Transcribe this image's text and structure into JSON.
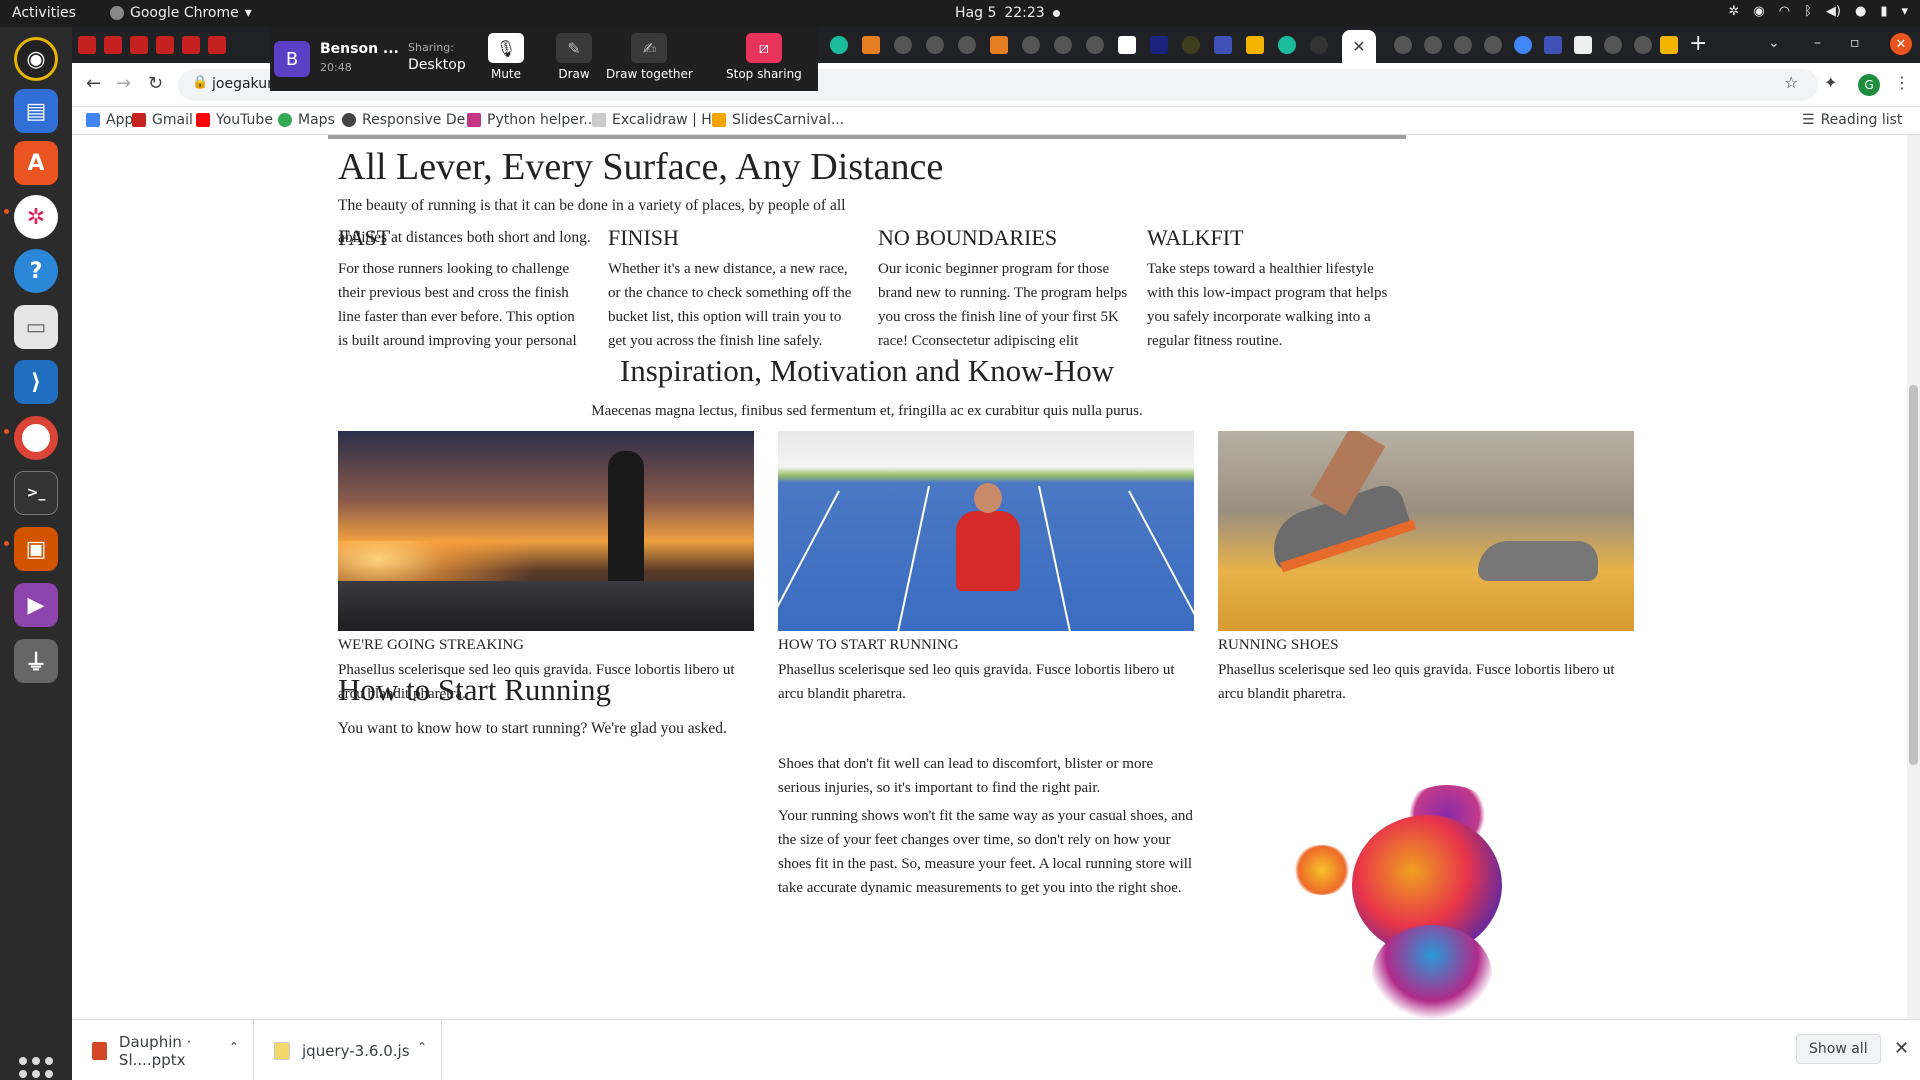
{
  "topbar": {
    "activities": "Activities",
    "app_name": "Google Chrome",
    "clock_day": "Hag 5",
    "clock_time": "22:23"
  },
  "share": {
    "avatar_letter": "B",
    "name": "Benson ...",
    "time": "20:48",
    "sharing_label": "Sharing:",
    "sharing_value": "Desktop",
    "mute": "Mute",
    "draw": "Draw",
    "draw_together": "Draw together",
    "stop_sharing": "Stop sharing"
  },
  "browser": {
    "url": "joegakur",
    "profile_letter": "G",
    "bookmarks": [
      "Apps",
      "Gmail",
      "YouTube",
      "Maps",
      "Responsive De...",
      "Python helper...",
      "Excalidraw | H...",
      "SlidesCarnival..."
    ],
    "reading_list": "Reading list"
  },
  "page": {
    "title": "All Lever, Every Surface, Any Distance",
    "intro_line1": "The beauty of running is that it can be done in a variety of places, by people of all",
    "intro_line2": "abilities at distances both short and long.",
    "features": [
      {
        "title": "FAST",
        "text": "For those runners looking to challenge their previous best and cross the finish line faster than ever before. This option is built around improving your personal"
      },
      {
        "title": "FINISH",
        "text": "Whether it's a new distance, a new race, or the chance to check something off the bucket list, this option will train you to get you across the finish line safely."
      },
      {
        "title": "NO BOUNDARIES",
        "text": "Our iconic beginner program for those brand new to running. The program helps you cross the finish line of your first 5K race! Cconsectetur adipiscing elit"
      },
      {
        "title": "WALKFIT",
        "text": "Take steps toward a healthier lifestyle with this low-impact program that helps you safely incorporate walking into a regular fitness routine."
      }
    ],
    "section_title": "Inspiration, Motivation and Know-How",
    "section_sub": "Maecenas magna lectus, finibus sed fermentum et, fringilla ac ex curabitur quis nulla purus.",
    "cards": [
      {
        "caption": "WE'RE GOING STREAKING",
        "text": "Phasellus scelerisque sed leo quis gravida. Fusce lobortis libero ut arcu blandit pharetra."
      },
      {
        "caption": "HOW TO START RUNNING",
        "text": "Phasellus scelerisque sed leo quis gravida. Fusce lobortis libero ut arcu blandit pharetra."
      },
      {
        "caption": "RUNNING SHOES",
        "text": "Phasellus scelerisque sed leo quis gravida. Fusce lobortis libero ut arcu blandit pharetra."
      }
    ],
    "how_title": "How to Start Running",
    "how_text": "You want to know how to start running? We're glad you asked.",
    "mid_p1": "Shoes that don't fit well can lead to discomfort, blister or more serious injuries, so it's important to find the right pair.",
    "mid_p2": "Your running shows won't fit the same way as your casual shoes, and the size of your feet changes over time, so don't rely on how your shoes fit in the past. So, measure your feet. A local running store will take accurate dynamic measurements to get you into the right shoe."
  },
  "downloads": {
    "file1": "Dauphin · Sl....pptx",
    "file2": "jquery-3.6.0.js",
    "show_all": "Show all"
  }
}
